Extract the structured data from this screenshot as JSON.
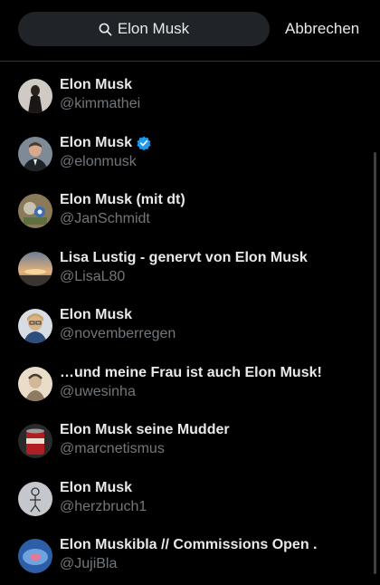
{
  "search": {
    "query": "Elon Musk",
    "cancel_label": "Abbrechen"
  },
  "results": [
    {
      "name": "Elon Musk",
      "handle": "@kimmathei",
      "verified": false,
      "avatar": "person-dark-dress-avatar"
    },
    {
      "name": "Elon Musk",
      "handle": "@elonmusk",
      "verified": true,
      "avatar": "man-suit-avatar"
    },
    {
      "name": "Elon Musk (mit dt)",
      "handle": "@JanSchmidt",
      "verified": false,
      "avatar": "cartoon-avatar"
    },
    {
      "name": "Lisa Lustig - genervt von Elon Musk",
      "handle": "@LisaL80",
      "verified": false,
      "avatar": "sunset-landscape-avatar"
    },
    {
      "name": "Elon Musk",
      "handle": "@novemberregen",
      "verified": false,
      "avatar": "woman-glasses-avatar"
    },
    {
      "name": "…und meine Frau ist auch Elon Musk!",
      "handle": "@uwesinha",
      "verified": false,
      "avatar": "sketch-portrait-avatar"
    },
    {
      "name": "Elon Musk seine Mudder",
      "handle": "@marcnetismus",
      "verified": false,
      "avatar": "red-can-avatar"
    },
    {
      "name": "Elon Musk",
      "handle": "@herzbruch1",
      "verified": false,
      "avatar": "drawing-figure-avatar"
    },
    {
      "name": "Elon Muskibla // Commissions Open .",
      "handle": "@JujiBla",
      "verified": false,
      "avatar": "blue-art-avatar"
    }
  ],
  "colors": {
    "background": "#000000",
    "text": "#e7e9ea",
    "secondary": "#71767b",
    "accent": "#1d9bf0",
    "search_bg": "#202327"
  }
}
